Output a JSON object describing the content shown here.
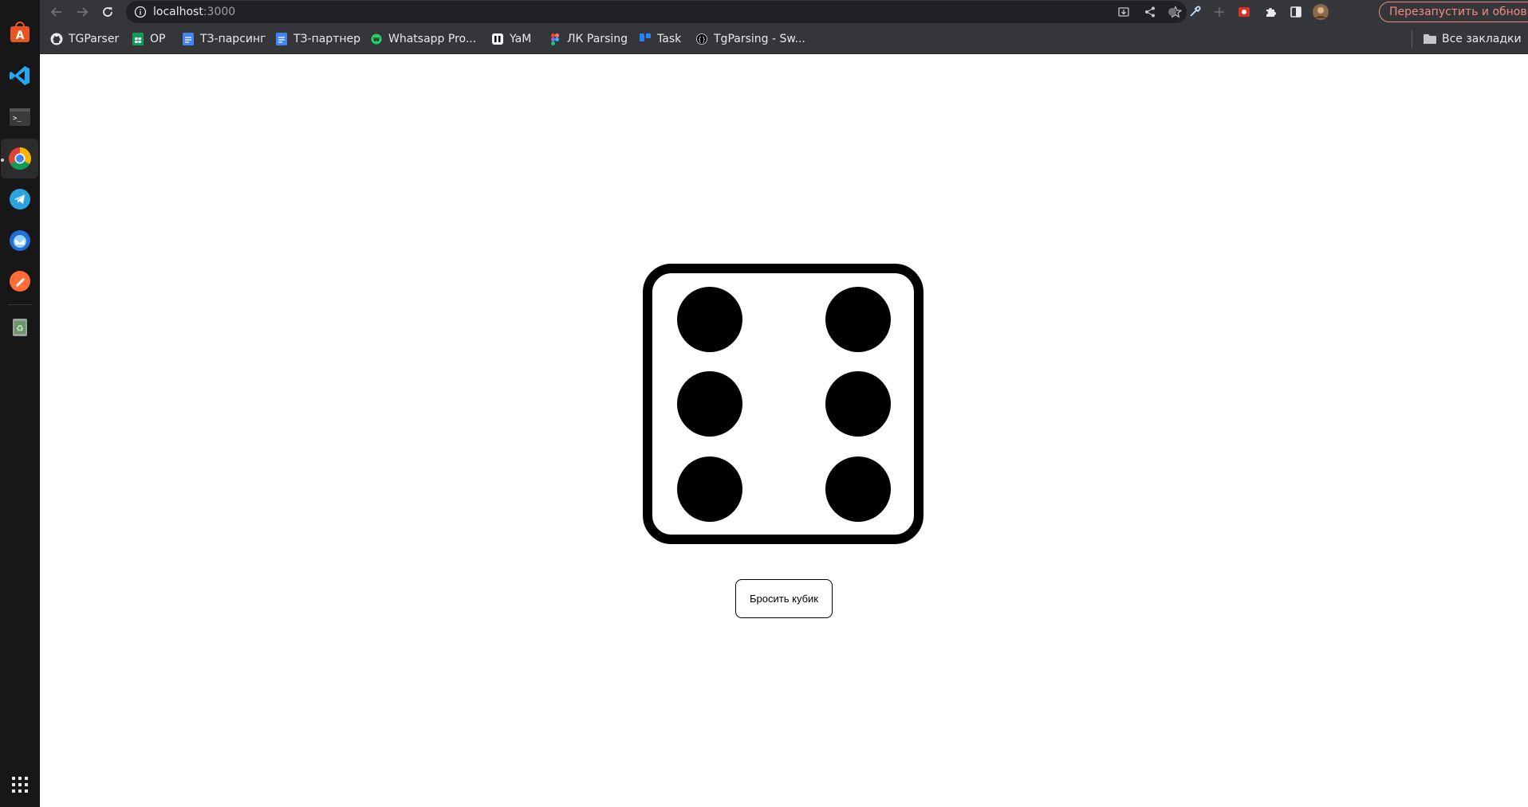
{
  "browser": {
    "url_host": "localhost",
    "url_port": ":3000",
    "restart_label": "Перезапустить и обновить",
    "restart_color": "#f28b82"
  },
  "bookmarks": [
    {
      "label": "TGParser",
      "icon": "github-icon"
    },
    {
      "label": "ОР",
      "icon": "sheets-icon"
    },
    {
      "label": "ТЗ-парсинг",
      "icon": "docs-icon"
    },
    {
      "label": "ТЗ-партнер",
      "icon": "docs-icon"
    },
    {
      "label": "Whatsapp Pro...",
      "icon": "whatsapp-icon"
    },
    {
      "label": "YaM",
      "icon": "yam-icon"
    },
    {
      "label": "ЛК Parsing",
      "icon": "figma-icon"
    },
    {
      "label": "Task",
      "icon": "trello-icon"
    },
    {
      "label": "TgParsing - Sw...",
      "icon": "swagger-icon"
    }
  ],
  "all_bookmarks_label": "Все закладки",
  "dock": [
    "app-center-icon",
    "vscode-icon",
    "terminal-icon",
    "chrome-icon",
    "telegram-icon",
    "thunderbird-icon",
    "postman-icon",
    "trash-icon",
    "show-apps-icon"
  ],
  "die": {
    "value": 6
  },
  "roll_button_label": "Бросить кубик"
}
